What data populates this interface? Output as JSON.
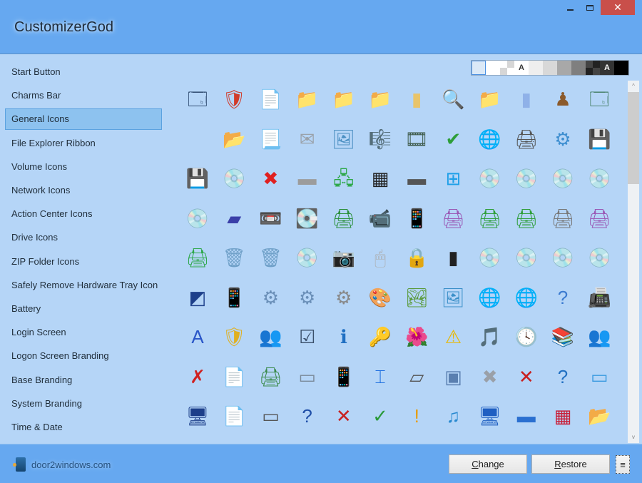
{
  "window": {
    "title": "CustomizerGod",
    "minimize_icon": "minimize-icon",
    "maximize_icon": "maximize-icon",
    "close_icon": "close-icon",
    "close_glyph": "✕",
    "close_color": "#c94f4a"
  },
  "sidebar": {
    "selected_index": 2,
    "items": [
      {
        "label": "Start Button"
      },
      {
        "label": "Charms Bar"
      },
      {
        "label": "General Icons"
      },
      {
        "label": "File Explorer Ribbon"
      },
      {
        "label": "Volume Icons"
      },
      {
        "label": "Network Icons"
      },
      {
        "label": "Action Center Icons"
      },
      {
        "label": "Drive Icons"
      },
      {
        "label": "ZIP Folder Icons"
      },
      {
        "label": "Safely Remove Hardware Tray Icon"
      },
      {
        "label": "Battery"
      },
      {
        "label": "Login Screen"
      },
      {
        "label": "Logon Screen Branding"
      },
      {
        "label": "Base Branding"
      },
      {
        "label": "System Branding"
      },
      {
        "label": "Time & Date"
      }
    ]
  },
  "background_swatches": {
    "selected_index": 0,
    "items": [
      {
        "color": "#dbe9f7",
        "label": ""
      },
      {
        "color": "#ffffff",
        "label": ""
      },
      {
        "color": "checker-light",
        "label": ""
      },
      {
        "color": "#ffffff",
        "label": "A",
        "text_color": "#333333"
      },
      {
        "color": "#eeeeee",
        "label": ""
      },
      {
        "color": "#d8d8d8",
        "label": ""
      },
      {
        "color": "#a8a8a8",
        "label": ""
      },
      {
        "color": "#7f7f7f",
        "label": ""
      },
      {
        "color": "checker-dark",
        "label": ""
      },
      {
        "color": "#333333",
        "label": "A",
        "text_color": "#ffffff"
      },
      {
        "color": "#000000",
        "label": ""
      }
    ]
  },
  "icon_grid": {
    "columns": 12,
    "icons": [
      {
        "name": "multi-window-icon",
        "glyph": "🗔",
        "color": "#1e3a5f"
      },
      {
        "name": "security-shield-icon",
        "glyph": "🛡",
        "color": "#d13b2a"
      },
      {
        "name": "blank-document-icon",
        "glyph": "📄",
        "color": "#ffffff"
      },
      {
        "name": "folder-icon",
        "glyph": "📁",
        "color": "#e9c46a"
      },
      {
        "name": "folder-open-icon",
        "glyph": "📁",
        "color": "#e9c46a"
      },
      {
        "name": "folder-back-icon",
        "glyph": "📁",
        "color": "#e9c46a"
      },
      {
        "name": "folder-narrow-icon",
        "glyph": "▮",
        "color": "#e9c46a"
      },
      {
        "name": "search-folder-icon",
        "glyph": "🔍",
        "color": "#8fb6e0"
      },
      {
        "name": "blue-folder-icon",
        "glyph": "📁",
        "color": "#8fb1e8"
      },
      {
        "name": "blue-folder-narrow-icon",
        "glyph": "▮",
        "color": "#8fb1e8"
      },
      {
        "name": "games-icon",
        "glyph": "♟",
        "color": "#8b5a2b"
      },
      {
        "name": "window-app-icon",
        "glyph": "🗔",
        "color": "#3e7a5e"
      },
      {
        "name": "empty-icon",
        "glyph": "",
        "color": "#cfe4fa"
      },
      {
        "name": "folder-search-icon",
        "glyph": "📂",
        "color": "#e9c46a"
      },
      {
        "name": "text-document-icon",
        "glyph": "📃",
        "color": "#ffffff"
      },
      {
        "name": "mail-envelope-icon",
        "glyph": "✉",
        "color": "#9aa2ab"
      },
      {
        "name": "picture-icon",
        "glyph": "🖼",
        "color": "#4a8fc2"
      },
      {
        "name": "music-sheet-icon",
        "glyph": "🎼",
        "color": "#444444"
      },
      {
        "name": "film-strip-icon",
        "glyph": "🎞",
        "color": "#3f5c4c"
      },
      {
        "name": "window-check-icon",
        "glyph": "✔",
        "color": "#2e9e3a"
      },
      {
        "name": "globe-monitor-icon",
        "glyph": "🌐",
        "color": "#1f7ac2"
      },
      {
        "name": "shared-printer-icon",
        "glyph": "🖨",
        "color": "#555555"
      },
      {
        "name": "control-panel-icon",
        "glyph": "⚙",
        "color": "#3d8ed0"
      },
      {
        "name": "floppy-drive-icon",
        "glyph": "💾",
        "color": "#9a59b5"
      },
      {
        "name": "floppy-drive-dark-icon",
        "glyph": "💾",
        "color": "#333333"
      },
      {
        "name": "cd-drive-icon",
        "glyph": "💿",
        "color": "#b0b0b0"
      },
      {
        "name": "drive-error-icon",
        "glyph": "✖",
        "color": "#e02020"
      },
      {
        "name": "hard-drive-icon",
        "glyph": "▬",
        "color": "#9c9c9c"
      },
      {
        "name": "network-drive-icon",
        "glyph": "🖧",
        "color": "#2ea84a"
      },
      {
        "name": "memory-chip-icon",
        "glyph": "▦",
        "color": "#222222"
      },
      {
        "name": "removable-drive-icon",
        "glyph": "▬",
        "color": "#555555"
      },
      {
        "name": "windows-drive-icon",
        "glyph": "⊞",
        "color": "#1fa0e8"
      },
      {
        "name": "dvd-drive-icon",
        "glyph": "💿",
        "color": "#888888"
      },
      {
        "name": "dvd-r-icon",
        "glyph": "💿",
        "color": "#aaaaaa"
      },
      {
        "name": "dvd-ram-icon",
        "glyph": "💿",
        "color": "#aaaaaa"
      },
      {
        "name": "dvd-rom-icon",
        "glyph": "💿",
        "color": "#aaaaaa"
      },
      {
        "name": "dvd-rw-icon",
        "glyph": "💿",
        "color": "#aaaaaa"
      },
      {
        "name": "blue-disk-icon",
        "glyph": "▰",
        "color": "#3a3fa8"
      },
      {
        "name": "tape-drive-icon",
        "glyph": "📼",
        "color": "#555555"
      },
      {
        "name": "zip-drive-icon",
        "glyph": "💽",
        "color": "#3a5fa8"
      },
      {
        "name": "network-printer-icon",
        "glyph": "🖨",
        "color": "#2a8f3a"
      },
      {
        "name": "video-camera-icon",
        "glyph": "📹",
        "color": "#3a4f7a"
      },
      {
        "name": "mobile-phone-icon",
        "glyph": "📱",
        "color": "#c8c8c8"
      },
      {
        "name": "fax-printer-check-icon",
        "glyph": "🖨",
        "color": "#9a59b5"
      },
      {
        "name": "printer-check-icon",
        "glyph": "🖨",
        "color": "#2e9e3a"
      },
      {
        "name": "printer-network-check-icon",
        "glyph": "🖨",
        "color": "#2e9e3a"
      },
      {
        "name": "printer-icon",
        "glyph": "🖨",
        "color": "#777777"
      },
      {
        "name": "fax-printer-icon",
        "glyph": "🖨",
        "color": "#9a59b5"
      },
      {
        "name": "printer-cable-icon",
        "glyph": "🖨",
        "color": "#2ea84a"
      },
      {
        "name": "recycle-bin-full-icon",
        "glyph": "🗑",
        "color": "#6fa0c8"
      },
      {
        "name": "recycle-bin-empty-icon",
        "glyph": "🗑",
        "color": "#6fa0c8"
      },
      {
        "name": "dvd-disc-icon",
        "glyph": "💿",
        "color": "#aaaaaa"
      },
      {
        "name": "camera-icon",
        "glyph": "📷",
        "color": "#555555"
      },
      {
        "name": "mouse-icon",
        "glyph": "🖱",
        "color": "#aaaaaa"
      },
      {
        "name": "lock-icon",
        "glyph": "🔒",
        "color": "#c9a227"
      },
      {
        "name": "memory-card-icon",
        "glyph": "▮",
        "color": "#222222"
      },
      {
        "name": "cd-disc-icon",
        "glyph": "💿",
        "color": "#aaaaaa"
      },
      {
        "name": "cd-r-icon",
        "glyph": "💿",
        "color": "#aaaaaa"
      },
      {
        "name": "cd-rom-icon",
        "glyph": "💿",
        "color": "#aaaaaa"
      },
      {
        "name": "cd-rw-icon",
        "glyph": "💿",
        "color": "#aaaaaa"
      },
      {
        "name": "media-center-icon",
        "glyph": "◩",
        "color": "#1d3f8a"
      },
      {
        "name": "phone-dock-icon",
        "glyph": "📱",
        "color": "#4a8fc2"
      },
      {
        "name": "settings-file-icon",
        "glyph": "⚙",
        "color": "#6a8fb8"
      },
      {
        "name": "settings-window-icon",
        "glyph": "⚙",
        "color": "#6a8fb8"
      },
      {
        "name": "gear-document-icon",
        "glyph": "⚙",
        "color": "#888888"
      },
      {
        "name": "paint-icon",
        "glyph": "🎨",
        "color": "#d8652a"
      },
      {
        "name": "landscape-picture-icon",
        "glyph": "🏞",
        "color": "#5a9a3a"
      },
      {
        "name": "wallpaper-icon",
        "glyph": "🖼",
        "color": "#3a8fc8"
      },
      {
        "name": "network-folder-icon",
        "glyph": "🌐",
        "color": "#2ea84a"
      },
      {
        "name": "network-folder-open-icon",
        "glyph": "🌐",
        "color": "#2ea84a"
      },
      {
        "name": "drive-question-icon",
        "glyph": "?",
        "color": "#3a7ad0"
      },
      {
        "name": "fax-machine-icon",
        "glyph": "📠",
        "color": "#666666"
      },
      {
        "name": "fonts-folder-icon",
        "glyph": "A",
        "color": "#2a56c8"
      },
      {
        "name": "uac-shield-icon",
        "glyph": "🛡",
        "color": "#e0b020"
      },
      {
        "name": "users-icon",
        "glyph": "👥",
        "color": "#4a8a3a"
      },
      {
        "name": "task-list-icon",
        "glyph": "☑",
        "color": "#3a4f6a"
      },
      {
        "name": "info-icon",
        "glyph": "ℹ",
        "color": "#1f6fc2"
      },
      {
        "name": "key-icon",
        "glyph": "🔑",
        "color": "#d89a2a"
      },
      {
        "name": "flower-picture-icon",
        "glyph": "🌺",
        "color": "#c83a1a"
      },
      {
        "name": "warning-icon",
        "glyph": "⚠",
        "color": "#e8b800"
      },
      {
        "name": "music-cd-icon",
        "glyph": "🎵",
        "color": "#2a8ad0"
      },
      {
        "name": "clock-icon",
        "glyph": "🕓",
        "color": "#1d3f8a"
      },
      {
        "name": "library-icon",
        "glyph": "📚",
        "color": "#7a8a9a"
      },
      {
        "name": "user-accounts-icon",
        "glyph": "👥",
        "color": "#4a8a3a"
      },
      {
        "name": "red-x-icon",
        "glyph": "✗",
        "color": "#d02020"
      },
      {
        "name": "rich-document-icon",
        "glyph": "📄",
        "color": "#3a6fc8"
      },
      {
        "name": "scanner-icon",
        "glyph": "🖨",
        "color": "#3a8a4a"
      },
      {
        "name": "panel-icon",
        "glyph": "▭",
        "color": "#7a8a9a"
      },
      {
        "name": "pda-icon",
        "glyph": "📱",
        "color": "#3a5fa8"
      },
      {
        "name": "text-cursor-field-icon",
        "glyph": "⌶",
        "color": "#1f6fe0"
      },
      {
        "name": "flatbed-scanner-icon",
        "glyph": "▱",
        "color": "#555555"
      },
      {
        "name": "tablet-icon",
        "glyph": "▣",
        "color": "#5a7fb0"
      },
      {
        "name": "grey-x-icon",
        "glyph": "✖",
        "color": "#9aa0a8"
      },
      {
        "name": "error-circle-icon",
        "glyph": "✕",
        "color": "#c82020"
      },
      {
        "name": "help-icon",
        "glyph": "?",
        "color": "#1f6fc2"
      },
      {
        "name": "minimize-window-icon",
        "glyph": "▭",
        "color": "#3a9ae0"
      },
      {
        "name": "monitor-moon-icon",
        "glyph": "🖥",
        "color": "#1d3f8a"
      },
      {
        "name": "plain-document-icon",
        "glyph": "📄",
        "color": "#eeeeee"
      },
      {
        "name": "projector-screen-icon",
        "glyph": "▭",
        "color": "#555555"
      },
      {
        "name": "question-shield-icon",
        "glyph": "?",
        "color": "#1f4fa8"
      },
      {
        "name": "error-shield-icon",
        "glyph": "✕",
        "color": "#c82020"
      },
      {
        "name": "check-shield-icon",
        "glyph": "✓",
        "color": "#2a9a3a"
      },
      {
        "name": "warning-shield-icon",
        "glyph": "!",
        "color": "#e89a00"
      },
      {
        "name": "music-folder-icon",
        "glyph": "♫",
        "color": "#2a8ad0"
      },
      {
        "name": "desktop-computer-icon",
        "glyph": "🖥",
        "color": "#1f5fc2"
      },
      {
        "name": "laptop-screen-icon",
        "glyph": "▬",
        "color": "#2a6fd0"
      },
      {
        "name": "programs-icon",
        "glyph": "▦",
        "color": "#c8203a"
      },
      {
        "name": "folder-document-icon",
        "glyph": "📂",
        "color": "#e9c46a"
      }
    ]
  },
  "scrollbar": {
    "up_glyph": "^",
    "down_glyph": "v",
    "scroll_position_fraction": 0.0,
    "visible_fraction": 0.27
  },
  "footer": {
    "logo_text": "door2windows.com",
    "change_button": {
      "accesskey": "C",
      "rest": "hange"
    },
    "restore_button": {
      "accesskey": "R",
      "rest": "estore"
    },
    "menu_glyph": "≡"
  }
}
